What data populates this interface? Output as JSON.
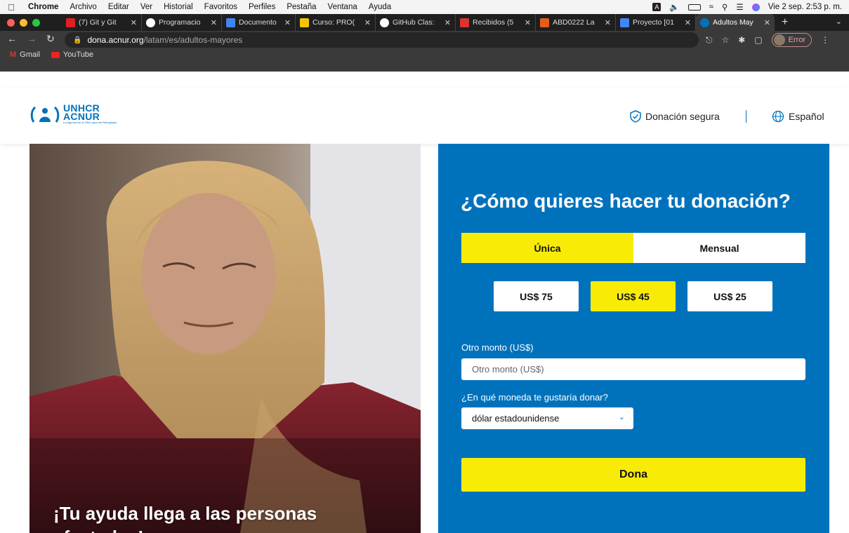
{
  "menubar": {
    "app": "Chrome",
    "items": [
      "Archivo",
      "Editar",
      "Ver",
      "Historial",
      "Favoritos",
      "Perfiles",
      "Pestaña",
      "Ventana",
      "Ayuda"
    ],
    "input_indicator": "A",
    "datetime": "Vie 2 sep.  2:53 p. m."
  },
  "tabs": [
    {
      "label": "(7) Git y Git",
      "favicon_color": "#e02020"
    },
    {
      "label": "Programacio",
      "favicon_color": "#ffffff"
    },
    {
      "label": "Documento",
      "favicon_color": "#4285f4"
    },
    {
      "label": "Curso: PRO(",
      "favicon_color": "#f6c400"
    },
    {
      "label": "GitHub Clas:",
      "favicon_color": "#ffffff"
    },
    {
      "label": "Recibidos (5",
      "favicon_color": "#d33"
    },
    {
      "label": "ABD0222 La",
      "favicon_color": "#e85d1c"
    },
    {
      "label": "Proyecto [01",
      "favicon_color": "#4285f4"
    },
    {
      "label": "Adultos May",
      "favicon_color": "#0072bc"
    }
  ],
  "url": {
    "host": "dona.acnur.org",
    "path": "/latam/es/adultos-mayores"
  },
  "profile": {
    "label": "Error"
  },
  "bookmarks": [
    {
      "label": "Gmail"
    },
    {
      "label": "YouTube"
    }
  ],
  "header": {
    "logo_line1": "UNHCR",
    "logo_line2": "ACNUR",
    "logo_tagline": "La Agencia de la ONU para los Refugiados",
    "secure_label": "Donación segura",
    "language_label": "Español"
  },
  "hero": {
    "caption": "¡Tu ayuda llega a las personas afectadas!"
  },
  "donation": {
    "title": "¿Cómo quieres hacer tu donación?",
    "frequency": [
      {
        "label": "Única",
        "selected": true
      },
      {
        "label": "Mensual",
        "selected": false
      }
    ],
    "amounts": [
      {
        "label": "US$ 75",
        "selected": false
      },
      {
        "label": "US$ 45",
        "selected": true
      },
      {
        "label": "US$ 25",
        "selected": false
      }
    ],
    "other_label": "Otro monto (US$)",
    "other_placeholder": "Otro monto (US$)",
    "currency_label": "¿En qué moneda te gustaría donar?",
    "currency_value": "dólar estadounidense",
    "submit_label": "Dona"
  },
  "colors": {
    "brand_blue": "#0072bc",
    "accent_yellow": "#f8ec07"
  }
}
